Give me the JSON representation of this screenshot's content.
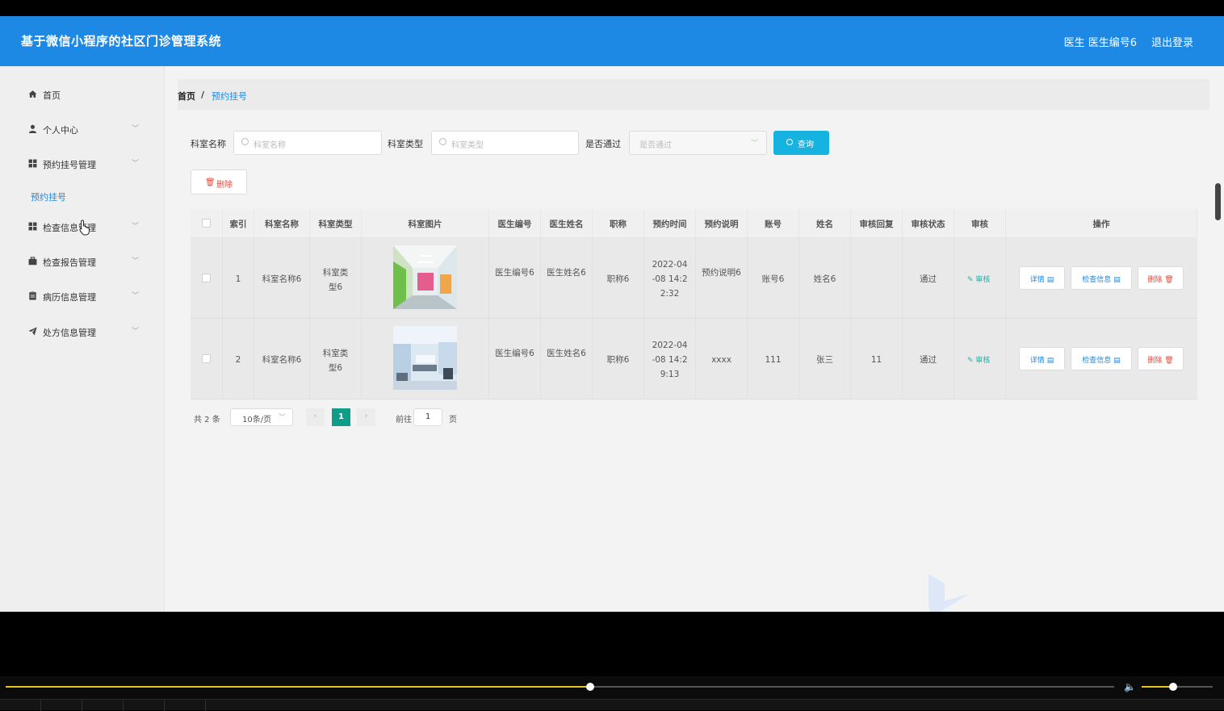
{
  "header": {
    "title": "基于微信小程序的社区门诊管理系统",
    "user": "医生 医生编号6",
    "logout": "退出登录"
  },
  "sidebar": {
    "items": [
      {
        "label": "首页",
        "icon": "home-icon"
      },
      {
        "label": "个人中心",
        "icon": "user-icon"
      },
      {
        "label": "预约挂号管理",
        "icon": "grid-icon"
      },
      {
        "label": "检查信息管理",
        "icon": "grid-icon"
      },
      {
        "label": "检查报告管理",
        "icon": "briefcase-icon"
      },
      {
        "label": "病历信息管理",
        "icon": "clipboard-icon"
      },
      {
        "label": "处方信息管理",
        "icon": "send-icon"
      }
    ],
    "submenu": {
      "label": "预约挂号"
    }
  },
  "breadcrumb": {
    "home": "首页",
    "sep": "/",
    "current": "预约挂号"
  },
  "filters": {
    "dept_name_label": "科室名称",
    "dept_name_placeholder": "科室名称",
    "dept_type_label": "科室类型",
    "dept_type_placeholder": "科室类型",
    "passed_label": "是否通过",
    "passed_placeholder": "是否通过",
    "query_label": "查询"
  },
  "actions": {
    "delete_label": "删除"
  },
  "table": {
    "headers": [
      "索引",
      "科室名称",
      "科室类型",
      "科室图片",
      "医生编号",
      "医生姓名",
      "职称",
      "预约时间",
      "预约说明",
      "账号",
      "姓名",
      "审核回复",
      "审核状态",
      "审核",
      "操作"
    ],
    "rows": [
      {
        "index": "1",
        "dept_name": "科室名称6",
        "dept_type": "科室类型6",
        "doctor_no": "医生编号6",
        "doctor_name": "医生姓名6",
        "title": "职称6",
        "time": "2022-04-08 14:22:32",
        "note": "预约说明6",
        "account": "账号6",
        "name": "姓名6",
        "reply": "",
        "status": "通过",
        "audit": "审核",
        "ops": {
          "detail": "详情",
          "check": "检查信息",
          "delete": "删除"
        }
      },
      {
        "index": "2",
        "dept_name": "科室名称6",
        "dept_type": "科室类型6",
        "doctor_no": "医生编号6",
        "doctor_name": "医生姓名6",
        "title": "职称6",
        "time": "2022-04-08 14:29:13",
        "note": "xxxx",
        "account": "111",
        "name": "张三",
        "reply": "11",
        "status": "通过",
        "audit": "审核",
        "ops": {
          "detail": "详情",
          "check": "检查信息",
          "delete": "删除"
        }
      }
    ]
  },
  "pagination": {
    "total": "共 2 条",
    "page_size": "10条/页",
    "current": "1",
    "goto_label": "前往",
    "goto_value": "1",
    "page_suffix": "页"
  },
  "player": {
    "progress": 0.527,
    "volume": 0.44
  },
  "colors": {
    "header": "#1e88e5",
    "query": "#17b3e0",
    "active_page": "#0f9d8a",
    "danger": "#e64a3b",
    "accent": "#e8c31a"
  }
}
